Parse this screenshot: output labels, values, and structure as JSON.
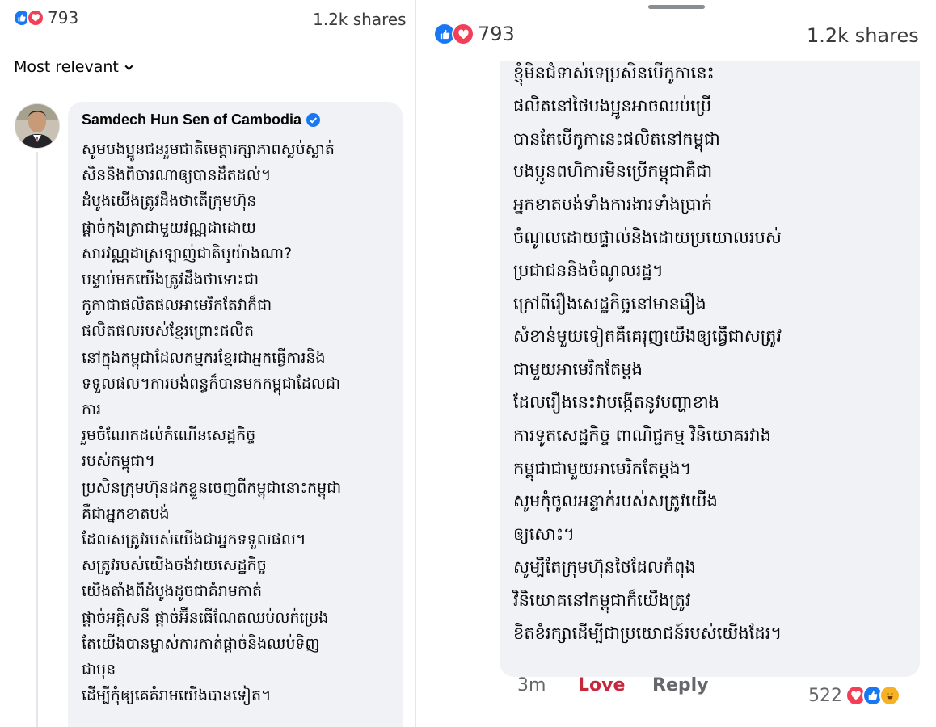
{
  "left": {
    "reaction_count": "793",
    "shares": "1.2k shares",
    "sort_label": "Most relevant",
    "comment": {
      "author": "Samdech Hun Sen of Cambodia",
      "lines": [
        "សូមបងប្អូនជនរួមជាតិមេត្តារក្សាភាពស្ងប់ស្ងាត់",
        "សិននិងពិចារណាឲ្យបានដឹតដល់។",
        "ដំបូងយើងត្រូវដឹងថាតើក្រុមហ៊ុន",
        "ផ្តាច់កុងត្រាជាមួយវណ្ណដាដោយ",
        "សារវណ្ណដាស្រឡាញ់ជាតិឬយ៉ាងណា?",
        "បន្ទាប់មកយើងត្រូវដឹងថាទោះជា",
        "កូកាជាផលិតផលអាមេរិកតែវាក៏ជា",
        "ផលិតផលរបស់ខ្មែរព្រោះផលិត",
        "នៅក្នុងកម្ពុជាដែលកម្មករខ្មែរជាអ្នកធ្វើការនិង",
        "ទទួលផល។ការបង់ពន្ធក៏បានមកកម្ពុជាដែលជា",
        "ការ",
        "រួមចំណែកដល់កំណើនសេដ្ឋកិច្ច",
        "របស់កម្ពុជា។",
        "ប្រសិនក្រុមហ៊ុនដកខ្លួនចេញពីកម្ពុជានោះកម្ពុជា",
        "គឺជាអ្នកខាតបង់",
        "ដែលសត្រូវរបស់យើងជាអ្នកទទួលផល។",
        "សត្រូវរបស់យើងចង់វាយសេដ្ឋកិច្ច",
        "យើងតាំងពីដំបូងដូចជាគំរាមកាត់",
        "ផ្តាច់អគ្គិសនី ផ្តាច់អ៊ីនធើណែតឈប់លក់ប្រេង",
        "តែយើងបានម្ចាស់ការកាត់ផ្តាច់និងឈប់ទិញ",
        "ជាមុន",
        "ដើម្បីកុំឲ្យគេគំរាមយើងបានទៀត។"
      ]
    }
  },
  "right": {
    "reaction_count": "793",
    "shares": "1.2k shares",
    "lines": [
      "ខ្ញុំមិនជំទាស់ទេប្រសិនបើកូកានេះ",
      "ផលិតនៅថៃបងប្អូនអាចឈប់ប្រើ",
      "បានតែបើកូកានេះផលិតនៅកម្ពុជា",
      "បងប្អូនពហិការមិនប្រើកម្ពុជាគឺជា",
      "អ្នកខាតបង់ទាំងការងារទាំងប្រាក់",
      "ចំណូលដោយផ្ទាល់និងដោយប្រយោលរបស់",
      "ប្រជាជននិងចំណូលរដ្ឋ។",
      "ក្រៅពីរឿងសេដ្ឋកិច្ចនៅមានរឿង",
      "សំខាន់មួយទៀតគឺគេរុញយើងឲ្យធ្វើជាសត្រូវ",
      "ជាមួយអាមេរិកតែម្តង",
      "ដែលរឿងនេះវាបង្កើតនូវបញ្ហាខាង",
      "ការទូតសេដ្ឋកិច្ច ពាណិជ្ជកម្ម វិនិយោគរវាង",
      "កម្ពុជាជាមួយអាមេរិកតែម្តង។",
      "សូមកុំចូលអន្ទាក់របស់សត្រូវយើង",
      "ឲ្យសោះ។",
      "សូម្បីតែក្រុមហ៊ុនថៃដែលកំពុង",
      "វិនិយោគនៅកម្ពុជាក៏យើងត្រូវ",
      "ខិតខំរក្សាដើម្បីជាប្រយោជន៍របស់យើងដែរ។"
    ],
    "time": "3m",
    "love_action": "Love",
    "reply_action": "Reply",
    "comment_reactions": "522"
  },
  "icons": {
    "like": "like-icon",
    "love": "love-icon",
    "haha": "haha-icon",
    "verified": "verified-badge-icon",
    "chevron": "chevron-down-icon"
  },
  "colors": {
    "like_blue": "#1877f2",
    "love_red": "#f33e58",
    "love_text": "#c5283d",
    "bubble": "#f0f2f5"
  }
}
